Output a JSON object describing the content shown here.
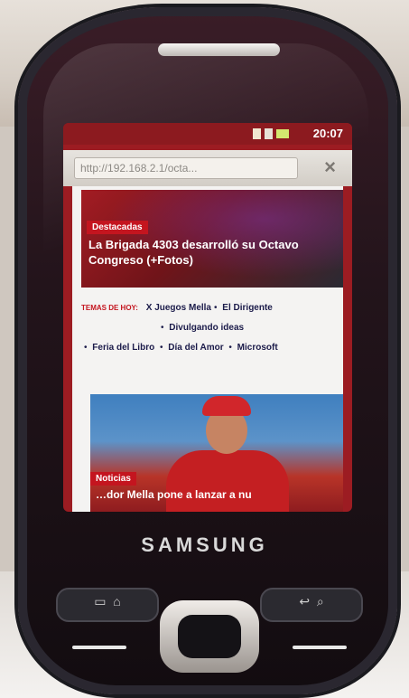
{
  "device": {
    "brand": "SAMSUNG"
  },
  "status_bar": {
    "time": "20:07"
  },
  "browser": {
    "url": "http://192.168.2.1/octa...",
    "close_label": "×"
  },
  "page": {
    "hero": {
      "tag": "Destacadas",
      "headline": "La Brigada 4303 desarrolló su Octavo Congreso (+Fotos)"
    },
    "topics": {
      "label": "TEMAS DE HOY:",
      "items": [
        "X Juegos Mella",
        "El Dirigente",
        "Divulgando ideas",
        "Feria del Libro",
        "Día del Amor",
        "Microsoft"
      ]
    },
    "story": {
      "tag": "Noticias",
      "caption": "…dor Mella pone a lanzar a nu"
    }
  }
}
